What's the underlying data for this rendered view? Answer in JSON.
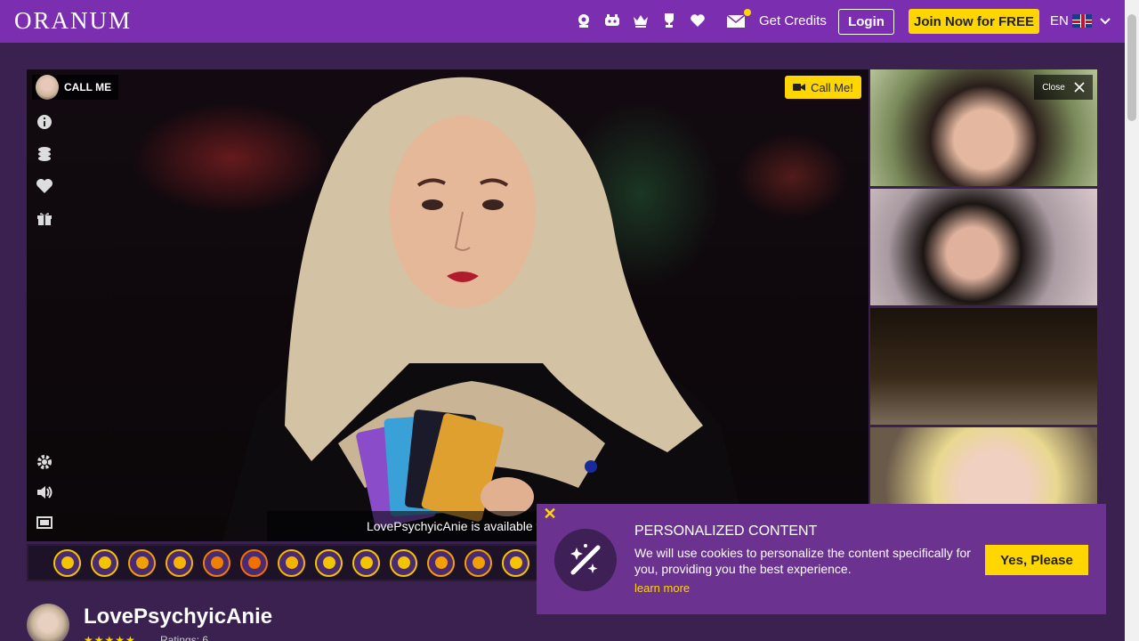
{
  "header": {
    "logo": "ORANUM",
    "get_credits": "Get Credits",
    "login": "Login",
    "join": "Join Now for FREE",
    "lang": "EN"
  },
  "video": {
    "call_me_tag": "CALL ME",
    "call_me_button": "Call Me!",
    "availability": "LovePsychyicAnie is available for a Video Call"
  },
  "thumbs": {
    "close_label": "Close"
  },
  "categories": [
    {
      "icon": "psychic-icon",
      "color": "#f5c400"
    },
    {
      "icon": "diamond-icon",
      "color": "#f5c400"
    },
    {
      "icon": "dreamcatcher-icon",
      "color": "#f0a000"
    },
    {
      "icon": "cat-icon",
      "color": "#f5b400"
    },
    {
      "icon": "heart-icon",
      "color": "#f08000"
    },
    {
      "icon": "sun-icon",
      "color": "#f07000"
    },
    {
      "icon": "phoenix-icon",
      "color": "#f5b400"
    },
    {
      "icon": "yin-yang-icon",
      "color": "#f5c400"
    },
    {
      "icon": "lotus-icon",
      "color": "#f5c400"
    },
    {
      "icon": "eye-icon",
      "color": "#f5c400"
    },
    {
      "icon": "hamsa-icon",
      "color": "#f5a000"
    },
    {
      "icon": "tree-icon",
      "color": "#f0a000"
    },
    {
      "icon": "meditation-icon",
      "color": "#f5c400"
    }
  ],
  "profile": {
    "name": "LovePsychyicAnie",
    "stars": "★★★★★",
    "ratings": "Ratings: 6"
  },
  "cookie": {
    "title": "PERSONALIZED CONTENT",
    "text": "We will use cookies to personalize the content specifically for you, providing you the best experience.",
    "learn_more": "learn more",
    "accept": "Yes, Please",
    "close": "✕"
  }
}
